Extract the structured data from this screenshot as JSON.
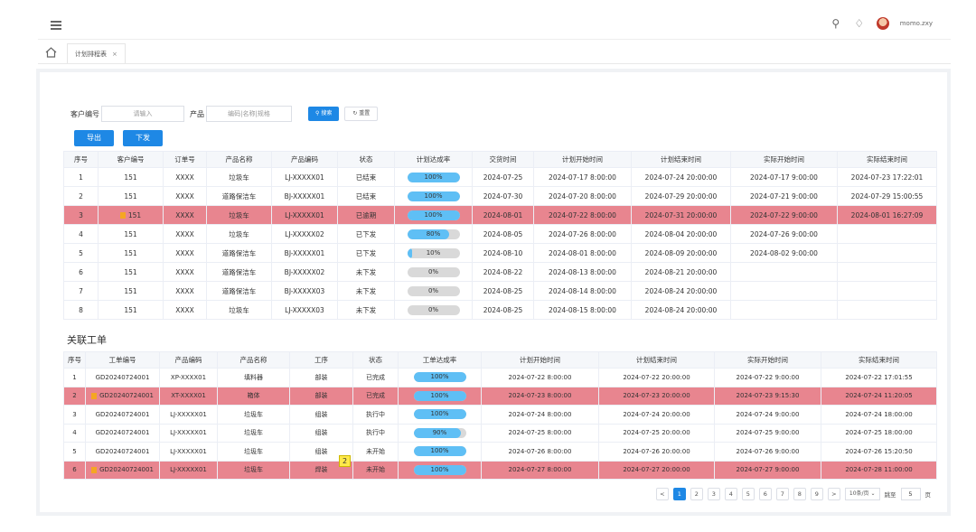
{
  "header": {
    "username": "momo.zxy"
  },
  "tabs": [
    {
      "label": "计划排程表",
      "close": "×"
    }
  ],
  "filter": {
    "customer_label": "客户编号",
    "customer_placeholder": "请输入",
    "product_label": "产品",
    "product_placeholder": "编码|名称|规格",
    "search_label": "搜索",
    "reset_label": "重置"
  },
  "actions": {
    "export": "导出",
    "issue": "下发"
  },
  "plan_table": {
    "headers": [
      "序号",
      "客户编号",
      "订单号",
      "产品名称",
      "产品编码",
      "状态",
      "计划达成率",
      "交货时间",
      "计划开始时间",
      "计划结束时间",
      "实际开始时间",
      "实际结束时间"
    ],
    "rows": [
      {
        "no": "1",
        "cust": "151",
        "order": "XXXX",
        "name": "垃圾车",
        "code": "LJ-XXXXX01",
        "status": "已结束",
        "rate": "100%",
        "pct": 1.0,
        "delivery": "2024-07-25",
        "ps": "2024-07-17   8:00:00",
        "pe": "2024-07-24   20:00:00",
        "as": "2024-07-17   9:00:00",
        "ae": "2024-07-23   17:22:01",
        "red": false
      },
      {
        "no": "2",
        "cust": "151",
        "order": "XXXX",
        "name": "道路保洁车",
        "code": "BJ-XXXXX01",
        "status": "已结束",
        "rate": "100%",
        "pct": 1.0,
        "delivery": "2024-07-30",
        "ps": "2024-07-20   8:00:00",
        "pe": "2024-07-29   20:00:00",
        "as": "2024-07-21   9:00:00",
        "ae": "2024-07-29   15:00:55",
        "red": false
      },
      {
        "no": "3",
        "cust": "151",
        "order": "XXXX",
        "name": "垃圾车",
        "code": "LJ-XXXXX01",
        "status": "已逾期",
        "rate": "100%",
        "pct": 1.0,
        "delivery": "2024-08-01",
        "ps": "2024-07-22   8:00:00",
        "pe": "2024-07-31   20:00:00",
        "as": "2024-07-22   9:00:00",
        "ae": "2024-08-01   16:27:09",
        "red": true
      },
      {
        "no": "4",
        "cust": "151",
        "order": "XXXX",
        "name": "垃圾车",
        "code": "LJ-XXXXX02",
        "status": "已下发",
        "rate": "80%",
        "pct": 0.8,
        "delivery": "2024-08-05",
        "ps": "2024-07-26   8:00:00",
        "pe": "2024-08-04   20:00:00",
        "as": "2024-07-26   9:00:00",
        "ae": "",
        "red": false
      },
      {
        "no": "5",
        "cust": "151",
        "order": "XXXX",
        "name": "道路保洁车",
        "code": "BJ-XXXXX01",
        "status": "已下发",
        "rate": "10%",
        "pct": 0.1,
        "delivery": "2024-08-10",
        "ps": "2024-08-01   8:00:00",
        "pe": "2024-08-09   20:00:00",
        "as": "2024-08-02   9:00:00",
        "ae": "",
        "red": false
      },
      {
        "no": "6",
        "cust": "151",
        "order": "XXXX",
        "name": "道路保洁车",
        "code": "BJ-XXXXX02",
        "status": "未下发",
        "rate": "0%",
        "pct": 0,
        "delivery": "2024-08-22",
        "ps": "2024-08-13   8:00:00",
        "pe": "2024-08-21   20:00:00",
        "as": "",
        "ae": "",
        "red": false
      },
      {
        "no": "7",
        "cust": "151",
        "order": "XXXX",
        "name": "道路保洁车",
        "code": "BJ-XXXXX03",
        "status": "未下发",
        "rate": "0%",
        "pct": 0,
        "delivery": "2024-08-25",
        "ps": "2024-08-14   8:00:00",
        "pe": "2024-08-24   20:00:00",
        "as": "",
        "ae": "",
        "red": false
      },
      {
        "no": "8",
        "cust": "151",
        "order": "XXXX",
        "name": "垃圾车",
        "code": "LJ-XXXXX03",
        "status": "未下发",
        "rate": "0%",
        "pct": 0,
        "delivery": "2024-08-25",
        "ps": "2024-08-15   8:00:00",
        "pe": "2024-08-24   20:00:00",
        "as": "",
        "ae": "",
        "red": false
      }
    ]
  },
  "work_title": "关联工单",
  "work_table": {
    "headers": [
      "序号",
      "工单编号",
      "产品编码",
      "产品名称",
      "工序",
      "状态",
      "工单达成率",
      "计划开始时间",
      "计划结束时间",
      "实际开始时间",
      "实际结束时间"
    ],
    "rows": [
      {
        "no": "1",
        "wo": "GD20240724001",
        "code": "XP-XXXX01",
        "name": "填料器",
        "proc": "部装",
        "status": "已完成",
        "rate": "100%",
        "pct": 1.0,
        "ps": "2024-07-22   8:00:00",
        "pe": "2024-07-22   20:00:00",
        "as": "2024-07-22   9:00:00",
        "ae": "2024-07-22   17:01:55",
        "red": false
      },
      {
        "no": "2",
        "wo": "GD20240724001",
        "code": "XT-XXXX01",
        "name": "箱体",
        "proc": "部装",
        "status": "已完成",
        "rate": "100%",
        "pct": 1.0,
        "ps": "2024-07-23   8:00:00",
        "pe": "2024-07-23   20:00:00",
        "as": "2024-07-23   9:15:30",
        "ae": "2024-07-24   11:20:05",
        "red": true
      },
      {
        "no": "3",
        "wo": "GD20240724001",
        "code": "LJ-XXXXX01",
        "name": "垃圾车",
        "proc": "组装",
        "status": "执行中",
        "rate": "100%",
        "pct": 1.0,
        "ps": "2024-07-24   8:00:00",
        "pe": "2024-07-24   20:00:00",
        "as": "2024-07-24   9:00:00",
        "ae": "2024-07-24   18:00:00",
        "red": false
      },
      {
        "no": "4",
        "wo": "GD20240724001",
        "code": "LJ-XXXXX01",
        "name": "垃圾车",
        "proc": "组装",
        "status": "执行中",
        "rate": "90%",
        "pct": 0.9,
        "ps": "2024-07-25   8:00:00",
        "pe": "2024-07-25   20:00:00",
        "as": "2024-07-25   9:00:00",
        "ae": "2024-07-25   18:00:00",
        "red": false
      },
      {
        "no": "5",
        "wo": "GD20240724001",
        "code": "LJ-XXXXX01",
        "name": "垃圾车",
        "proc": "组装",
        "status": "未开始",
        "rate": "100%",
        "pct": 1.0,
        "ps": "2024-07-26   8:00:00",
        "pe": "2024-07-26   20:00:00",
        "as": "2024-07-26   9:00:00",
        "ae": "2024-07-26   15:20:50",
        "red": false
      },
      {
        "no": "6",
        "wo": "GD20240724001",
        "code": "LJ-XXXXX01",
        "name": "垃圾车",
        "proc": "焊装",
        "status": "未开始",
        "rate": "100%",
        "pct": 1.0,
        "ps": "2024-07-27   8:00:00",
        "pe": "2024-07-27   20:00:00",
        "as": "2024-07-27   9:00:00",
        "ae": "2024-07-28   11:00:00",
        "red": true
      }
    ]
  },
  "annotation_badge": "2",
  "pagination": {
    "pages": [
      "1",
      "2",
      "3",
      "4",
      "5",
      "6",
      "7",
      "8",
      "9"
    ],
    "prev": "<",
    "next": ">",
    "page_size": "10条/页",
    "goto_label": "跳至",
    "goto_value": "5",
    "page_unit": "页"
  }
}
